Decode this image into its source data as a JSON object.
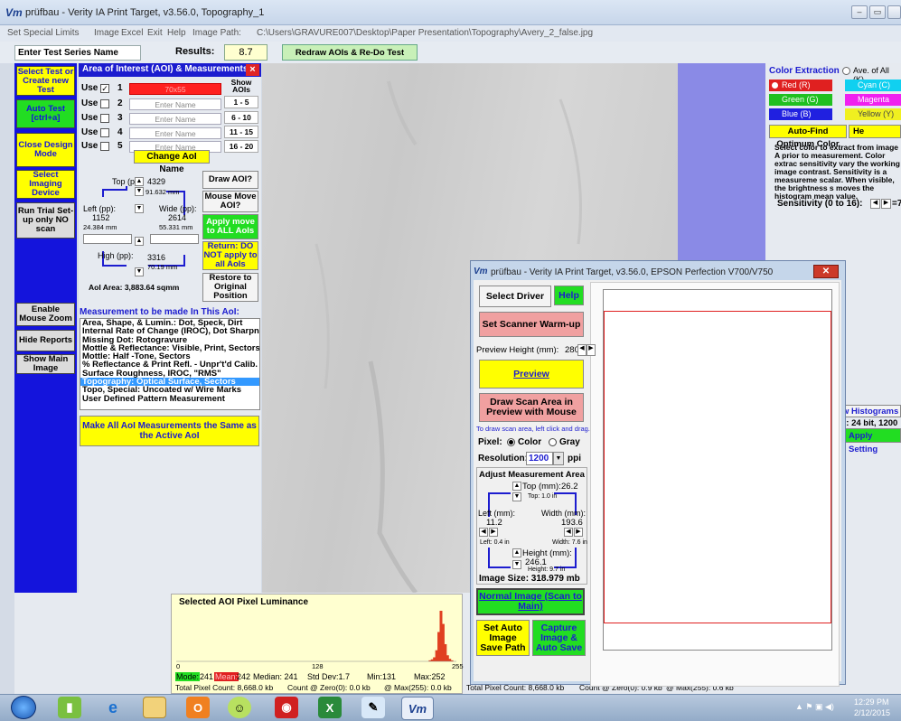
{
  "window": {
    "logo": "Vm",
    "title": "prüfbau - Verity IA Print Target, v3.56.0, Topography_1",
    "controls": [
      "–",
      "▭"
    ]
  },
  "menu": {
    "items": [
      "Set Special Limits",
      "Image",
      "Excel",
      "Exit",
      "Help",
      "Image Path:"
    ],
    "image_path": "C:\\Users\\GRAVURE007\\Desktop\\Paper Presentation\\Topography\\Avery_2_false.jpg"
  },
  "toolbar": {
    "series_name": "Enter Test Series Name",
    "results_label": "Results:",
    "results_value": "8.7",
    "redraw_label": "Redraw AOIs & Re-Do Test [ctrl+z]"
  },
  "left_buttons": [
    {
      "label": "Select Test or Create new Test"
    },
    {
      "label": "Auto Test [ctrl+a]"
    },
    {
      "label": "Close Design Mode"
    },
    {
      "label": "Select Imaging Device"
    },
    {
      "label": "Run Trial Set-up only NO scan"
    },
    {
      "label": "Enable Mouse Zoom"
    },
    {
      "label": "Hide Reports"
    },
    {
      "label": "Show Main Image"
    }
  ],
  "aoi": {
    "header": "Area of Interest (AOI) & Measurements",
    "show_aois_label": "Show AOIs",
    "use_label": "Use",
    "rows": [
      {
        "num": "1",
        "name": "70x55",
        "checked": "✓",
        "range": "1 - 5"
      },
      {
        "num": "2",
        "name": "Enter Name",
        "checked": "",
        "range": "6 - 10"
      },
      {
        "num": "3",
        "name": "Enter Name",
        "checked": "",
        "range": "11 - 15"
      },
      {
        "num": "4",
        "name": "Enter Name",
        "checked": "",
        "range": "16 - 20"
      },
      {
        "num": "5",
        "name": "Enter Name",
        "checked": "",
        "range": ""
      }
    ],
    "change_name": "Change AoI Name",
    "top_label": "Top (pp):",
    "top_value": "4329",
    "top_mm": "91.632 mm",
    "left_label": "Left (pp):",
    "left_value": "1152",
    "left_mm": "24.384 mm",
    "wide_label": "Wide (pp):",
    "wide_value": "2614",
    "wide_mm": "55.331 mm",
    "high_label": "High (pp):",
    "high_value": "3316",
    "high_mm": "70.19 mm",
    "area": "AoI Area: 3,883.64 sqmm",
    "draw_aoi": "Draw AOI?",
    "mouse_move": "Mouse Move AOI?",
    "apply_all": "Apply move to ALL AoIs",
    "return_btn": "Return: DO NOT apply to all AoIs",
    "restore_btn": "Restore to Original Position"
  },
  "measurements": {
    "title": "Measurement to be made In This AoI:",
    "items": [
      "Area, Shape, & Lumin.: Dot, Speck, Dirt",
      "Internal Rate of Change (IROC), Dot Sharpne",
      "Missing Dot: Rotogravure",
      "Mottle & Reflectance: Visible, Print, Sectors",
      "Mottle: Half -Tone, Sectors",
      "% Reflectance & Print Refl. - Unpr't'd Calib.",
      "Surface Roughness, IROC, \"RMS\"",
      "Topography: Optical Surface, Sectors",
      "Topo, Special: Uncoated w/ Wire Marks",
      "User Defined Pattern Measurement"
    ],
    "selected_index": 7,
    "make_all": "Make All AoI Measurements the Same as the Active AoI"
  },
  "color_extraction": {
    "title": "Color Extraction",
    "ave_label": "Ave. of All (K)",
    "options": [
      {
        "label": "Red (R)",
        "color": "#e02020",
        "selected": true
      },
      {
        "label": "Cyan (C)",
        "color": "#10d0f0",
        "selected": false
      },
      {
        "label": "Green (G)",
        "color": "#20c020",
        "selected": false
      },
      {
        "label": "Magenta (M)",
        "color": "#f020f0",
        "selected": false
      },
      {
        "label": "Blue (B)",
        "color": "#2020e0",
        "selected": false
      },
      {
        "label": "Yellow (Y)",
        "color": "#f0f020",
        "selected": false
      }
    ],
    "autofind": "Auto-Find Optimum Color",
    "help_short": "He",
    "desc": "Select color to extract from image A prior to measurement. Color extrac sensitivity vary the working image contrast. Sensitivity is a measureme scalar. When visible, the brightness s moves the histogram mean value.",
    "sensitivity_label": "Sensitivity (0 to 16):",
    "sensitivity_value": "=7",
    "histograms_btn": "w Histograms",
    "bit_label": "e: 24 bit, 1200",
    "apply_settings": "Apply Setting"
  },
  "histogram": {
    "title": "Selected AOI Pixel Luminance",
    "axis_min": "0",
    "axis_mid": "128",
    "axis_max": "255",
    "mode_label": "Mode:",
    "mode_value": "241",
    "mean_label": "Mean:",
    "mean_value": "242",
    "median": "Median: 241",
    "stddev": "Std Dev:1.7",
    "min": "Min:131",
    "max": "Max:252",
    "total_count": "Total Pixel Count: 8,668.0 kb",
    "zero_count": "Count @ Zero(0): 0.0 kb",
    "max_count": "@ Max(255): 0.0 kb",
    "color_main": "#e04020",
    "chart_data": {
      "type": "bar",
      "x": [
        231,
        233,
        235,
        237,
        239,
        241,
        243,
        245,
        247,
        249,
        251
      ],
      "values": [
        2,
        4,
        8,
        22,
        58,
        100,
        74,
        34,
        12,
        5,
        2
      ],
      "xlim": [
        0,
        255
      ]
    }
  },
  "dialog": {
    "logo": "Vm",
    "title": "prüfbau - Verity IA Print Target, v3.56.0, EPSON Perfection V700/V750",
    "close": "✕",
    "select_driver": "Select Driver",
    "help": "Help",
    "warmup": "Set Scanner Warm-up",
    "preview_height_label": "Preview Height (mm):",
    "preview_height_value": "280",
    "preview": "Preview",
    "draw_scan": "Draw Scan Area in Preview with Mouse",
    "draw_hint": "To draw scan area, left click and drag.",
    "pixel_label": "Pixel:",
    "color_opt": "Color",
    "gray_opt": "Gray",
    "resolution_label": "Resolution:",
    "resolution_value": "1200",
    "ppi": "ppi",
    "adjust_title": "Adjust Measurement Area",
    "top_mm_label": "Top (mm):",
    "top_mm_value": "26.2",
    "top_in": "Top: 1.0 in",
    "left_mm_label": "Left (mm):",
    "left_mm_value": "11.2",
    "left_in": "Left: 0.4 in",
    "width_mm_label": "Width (mm):",
    "width_mm_value": "193.6",
    "width_in": "Width: 7.6 in",
    "height_mm_label": "Height (mm):",
    "height_mm_value": "246.1",
    "height_in": "Height: 9.7 in",
    "image_size": "Image Size: 318.979 mb",
    "normal_image": "Normal Image (Scan to Main)",
    "set_auto_save": "Set Auto Image Save Path",
    "capture_save": "Capture Image & Auto Save",
    "frame_color": "#e02020"
  },
  "status": {
    "right_total": "Total Pixel Count: 8,668.0 kb",
    "right_zero": "Count @ Zero(0): 0.9 kb",
    "right_max": "@ Max(255): 0.6 kb"
  },
  "taskbar": {
    "time": "12:29 PM",
    "date": "2/12/2015",
    "icons": [
      "start-orb",
      "bar-chart-app",
      "internet-explorer",
      "file-explorer",
      "outlook",
      "smile-app",
      "camera-app",
      "excel",
      "paint",
      "verity-app"
    ]
  }
}
